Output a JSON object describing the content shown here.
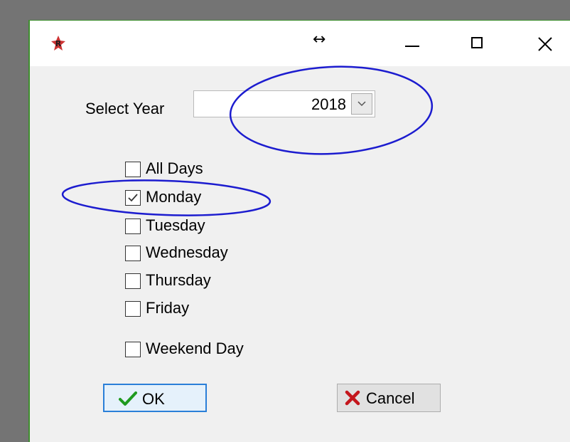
{
  "window": {
    "resize_glyph": "↔",
    "controls": [
      "minimize",
      "maximize",
      "close"
    ]
  },
  "year": {
    "label": "Select Year",
    "selected": "2018"
  },
  "days": [
    {
      "label": "All Days",
      "checked": false
    },
    {
      "label": "Monday",
      "checked": true
    },
    {
      "label": "Tuesday",
      "checked": false
    },
    {
      "label": "Wednesday",
      "checked": false
    },
    {
      "label": "Thursday",
      "checked": false
    },
    {
      "label": "Friday",
      "checked": false
    },
    {
      "label": "Weekend Day",
      "checked": false
    }
  ],
  "buttons": {
    "ok": "OK",
    "cancel": "Cancel"
  },
  "icons": {
    "app": "r-logo-icon",
    "ok": "green-check-icon",
    "cancel": "red-x-icon"
  },
  "colors": {
    "annotation": "#1c1ccf",
    "ok_check": "#1f9a1f",
    "cancel_x": "#c4161c",
    "focus_border": "#2a7fd8",
    "window_border": "#3f8f2f"
  }
}
